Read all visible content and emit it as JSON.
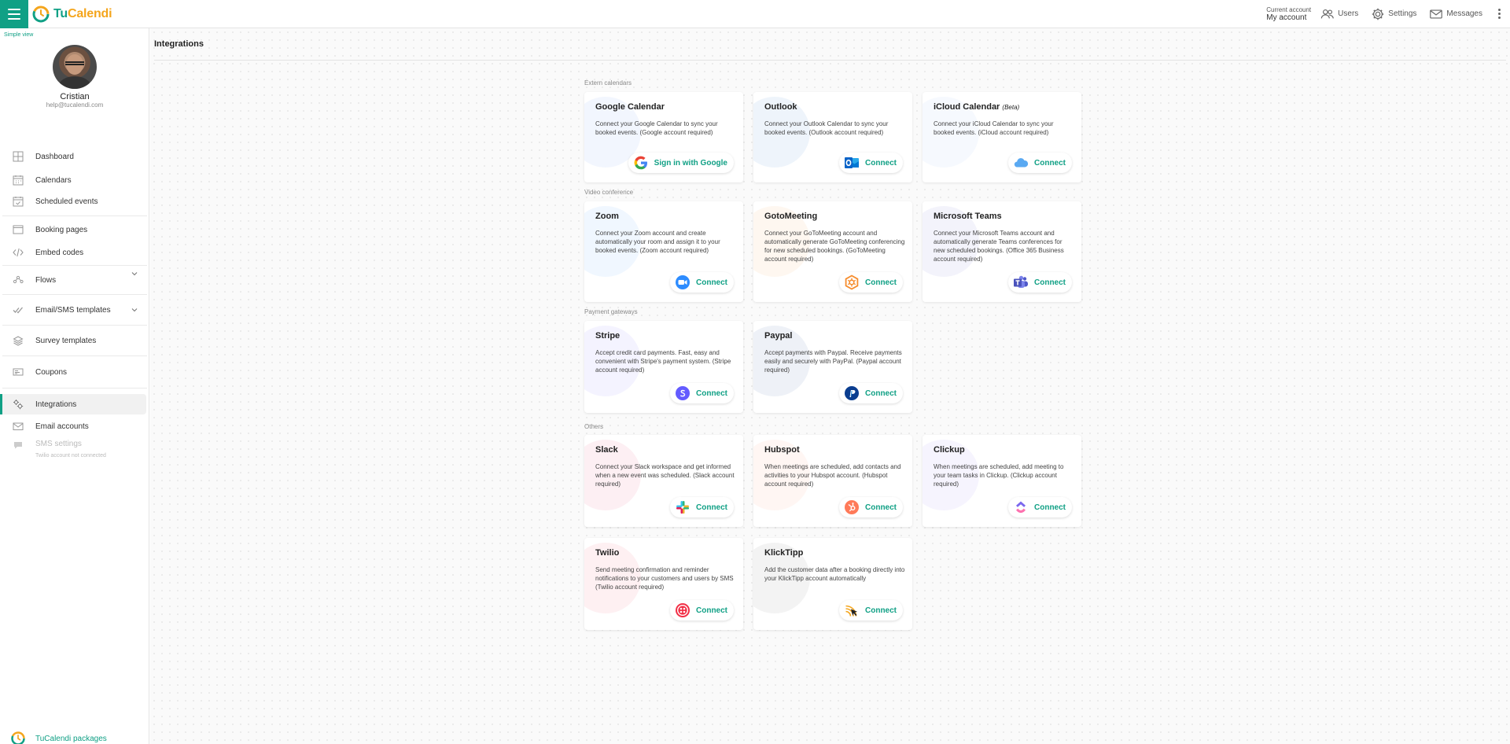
{
  "colors": {
    "accent": "#10a085",
    "brand_orange": "#f4a51c"
  },
  "header": {
    "logo_prefix": "Tu",
    "logo_suffix": "Calendi",
    "account_caption": "Current account",
    "account_name": "My account",
    "users": "Users",
    "settings": "Settings",
    "messages": "Messages"
  },
  "sidebar": {
    "simple_view": "Simple view",
    "profile": {
      "name": "Cristian",
      "email": "help@tucalendi.com"
    },
    "items": [
      {
        "label": "Dashboard",
        "icon": "dashboard-icon"
      },
      {
        "label": "Calendars",
        "icon": "calendar-icon"
      },
      {
        "label": "Scheduled events",
        "icon": "calendar-check-icon"
      },
      {
        "label": "Booking pages",
        "icon": "window-icon"
      },
      {
        "label": "Embed codes",
        "icon": "code-icon"
      },
      {
        "label": "Flows",
        "icon": "flow-icon"
      },
      {
        "label": "Email/SMS templates",
        "icon": "template-icon"
      },
      {
        "label": "Survey templates",
        "icon": "layers-icon"
      },
      {
        "label": "Coupons",
        "icon": "coupon-icon"
      },
      {
        "label": "Integrations",
        "icon": "gears-icon"
      },
      {
        "label": "Email accounts",
        "icon": "mail-icon"
      },
      {
        "label": "SMS settings",
        "sublabel": "Twilio account not connected",
        "icon": "chat-icon"
      }
    ],
    "packages": "TuCalendi packages"
  },
  "page": {
    "title": "Integrations"
  },
  "sections": {
    "calendars": "Extern calendars",
    "video": "Video conference",
    "payment": "Payment gateways",
    "others": "Others"
  },
  "cards": {
    "google": {
      "title": "Google Calendar",
      "desc": "Connect your Google Calendar to sync your booked events. (Google account required)",
      "button": "Sign in with Google"
    },
    "outlook": {
      "title": "Outlook",
      "desc": "Connect your Outlook Calendar to sync your booked events. (Outlook account required)",
      "button": "Connect"
    },
    "icloud": {
      "title": "iCloud Calendar",
      "badge": "(Beta)",
      "desc": "Connect your iCloud Calendar to sync your booked events. (iCloud account required)",
      "button": "Connect"
    },
    "zoom": {
      "title": "Zoom",
      "desc": "Connect your Zoom account and create automatically your room and assign it to your booked events. (Zoom account required)",
      "button": "Connect"
    },
    "gotomeeting": {
      "title": "GotoMeeting",
      "desc": "Connect your GoToMeeting account and automatically generate GoToMeeting conferencing for new scheduled bookings. (GoToMeeting account required)",
      "button": "Connect"
    },
    "teams": {
      "title": "Microsoft Teams",
      "desc": "Connect your Microsoft Teams account and automatically generate Teams conferences for new scheduled bookings. (Office 365 Business account required)",
      "button": "Connect"
    },
    "stripe": {
      "title": "Stripe",
      "desc": "Accept credit card payments. Fast, easy and convenient with Stripe's payment system. (Stripe account required)",
      "button": "Connect"
    },
    "paypal": {
      "title": "Paypal",
      "desc": "Accept payments with Paypal. Receive payments easily and securely with PayPal. (Paypal account required)",
      "button": "Connect"
    },
    "slack": {
      "title": "Slack",
      "desc": "Connect your Slack workspace and get informed when a new event was scheduled. (Slack account required)",
      "button": "Connect"
    },
    "hubspot": {
      "title": "Hubspot",
      "desc": "When meetings are scheduled, add contacts and activities to your Hubspot account. (Hubspot account required)",
      "button": "Connect"
    },
    "clickup": {
      "title": "Clickup",
      "desc": "When meetings are scheduled, add meeting to your team tasks in Clickup. (Clickup account required)",
      "button": "Connect"
    },
    "twilio": {
      "title": "Twilio",
      "desc": "Send meeting confirmation and reminder notifications to your customers and users by SMS (Twilio account required)",
      "button": "Connect"
    },
    "klicktipp": {
      "title": "KlickTipp",
      "desc": "Add the customer data after a booking directly into your KlickTipp account automatically",
      "button": "Connect"
    }
  }
}
